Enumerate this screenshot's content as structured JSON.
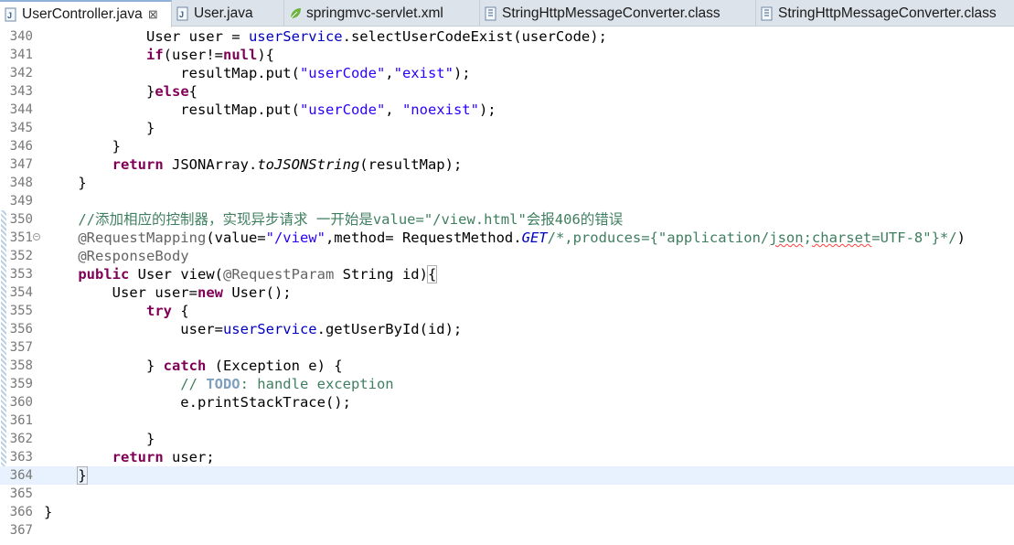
{
  "tabs": [
    {
      "label": "UserController.java",
      "icon": "java-file-icon",
      "active": true,
      "close": "⊠"
    },
    {
      "label": "User.java",
      "icon": "java-file-icon",
      "active": false
    },
    {
      "label": "springmvc-servlet.xml",
      "icon": "spring-xml-icon",
      "active": false
    },
    {
      "label": "StringHttpMessageConverter.class",
      "icon": "class-file-icon",
      "active": false
    },
    {
      "label": "StringHttpMessageConverter.class",
      "icon": "class-file-icon",
      "active": false
    }
  ],
  "lines": [
    {
      "n": "340",
      "segs": [
        [
          "            User user = ",
          ""
        ],
        [
          "userService",
          "field"
        ],
        [
          ".selectUserCodeExist(userCode);",
          ""
        ]
      ]
    },
    {
      "n": "341",
      "segs": [
        [
          "            ",
          ""
        ],
        [
          "if",
          "kw"
        ],
        [
          "(user!=",
          ""
        ],
        [
          "null",
          "kw"
        ],
        [
          "){",
          ""
        ]
      ]
    },
    {
      "n": "342",
      "segs": [
        [
          "                resultMap.put(",
          ""
        ],
        [
          "\"userCode\"",
          "str"
        ],
        [
          ",",
          ""
        ],
        [
          "\"exist\"",
          "str"
        ],
        [
          ");",
          ""
        ]
      ]
    },
    {
      "n": "343",
      "segs": [
        [
          "            }",
          ""
        ],
        [
          "else",
          "kw"
        ],
        [
          "{",
          ""
        ]
      ]
    },
    {
      "n": "344",
      "segs": [
        [
          "                resultMap.put(",
          ""
        ],
        [
          "\"userCode\"",
          "str"
        ],
        [
          ", ",
          ""
        ],
        [
          "\"noexist\"",
          "str"
        ],
        [
          ");",
          ""
        ]
      ]
    },
    {
      "n": "345",
      "segs": [
        [
          "            }",
          ""
        ]
      ]
    },
    {
      "n": "346",
      "segs": [
        [
          "        }",
          ""
        ]
      ]
    },
    {
      "n": "347",
      "segs": [
        [
          "        ",
          ""
        ],
        [
          "return",
          "kw"
        ],
        [
          " JSONArray.",
          ""
        ],
        [
          "toJSONString",
          "ital"
        ],
        [
          "(resultMap);",
          ""
        ]
      ]
    },
    {
      "n": "348",
      "segs": [
        [
          "    }",
          ""
        ]
      ]
    },
    {
      "n": "349",
      "segs": []
    },
    {
      "n": "350",
      "segs": [
        [
          "    //添加相应的控制器，实现异步请求 一开始是value=\"/view.html\"会报406的错误",
          "cmt"
        ]
      ]
    },
    {
      "n": "351",
      "fold": true,
      "segs": [
        [
          "    @RequestMapping",
          "ann"
        ],
        [
          "(value=",
          ""
        ],
        [
          "\"/view\"",
          "str"
        ],
        [
          ",method= RequestMethod.",
          ""
        ],
        [
          "GET",
          "field ital"
        ],
        [
          "/*,produces={\"application/",
          "cmt"
        ],
        [
          "json",
          "cmt squig"
        ],
        [
          ";",
          "cmt"
        ],
        [
          "charset",
          "cmt squig"
        ],
        [
          "=UTF-8\"}*/",
          "cmt"
        ],
        [
          ")",
          ""
        ]
      ]
    },
    {
      "n": "352",
      "segs": [
        [
          "    @ResponseBody",
          "ann"
        ]
      ]
    },
    {
      "n": "353",
      "segs": [
        [
          "    ",
          ""
        ],
        [
          "public",
          "kw"
        ],
        [
          " User view(",
          ""
        ],
        [
          "@RequestParam",
          "ann"
        ],
        [
          " String id)",
          ""
        ],
        [
          "{",
          "bracket"
        ]
      ]
    },
    {
      "n": "354",
      "segs": [
        [
          "        User user=",
          ""
        ],
        [
          "new",
          "kw"
        ],
        [
          " User();",
          ""
        ]
      ]
    },
    {
      "n": "355",
      "segs": [
        [
          "            ",
          ""
        ],
        [
          "try",
          "kw"
        ],
        [
          " {",
          ""
        ]
      ]
    },
    {
      "n": "356",
      "segs": [
        [
          "                user=",
          ""
        ],
        [
          "userService",
          "field"
        ],
        [
          ".getUserById(id);",
          ""
        ]
      ]
    },
    {
      "n": "357",
      "segs": []
    },
    {
      "n": "358",
      "segs": [
        [
          "            } ",
          ""
        ],
        [
          "catch",
          "kw"
        ],
        [
          " (Exception e) {",
          ""
        ]
      ]
    },
    {
      "n": "359",
      "segs": [
        [
          "                // ",
          "cmt"
        ],
        [
          "TODO",
          "todo"
        ],
        [
          ": handle exception",
          "cmt"
        ]
      ]
    },
    {
      "n": "360",
      "segs": [
        [
          "                e.printStackTrace();",
          ""
        ]
      ]
    },
    {
      "n": "361",
      "segs": []
    },
    {
      "n": "362",
      "segs": [
        [
          "            }",
          ""
        ]
      ]
    },
    {
      "n": "363",
      "segs": [
        [
          "        ",
          ""
        ],
        [
          "return",
          "kw"
        ],
        [
          " user;",
          ""
        ]
      ]
    },
    {
      "n": "364",
      "current": true,
      "segs": [
        [
          "    ",
          ""
        ],
        [
          "}",
          "bracket"
        ]
      ]
    },
    {
      "n": "365",
      "segs": []
    },
    {
      "n": "366",
      "segs": [
        [
          "}",
          ""
        ]
      ]
    },
    {
      "n": "367",
      "segs": []
    }
  ],
  "colors": {
    "keyword": "#7f0055",
    "string": "#2a00ff",
    "field": "#0000c0",
    "comment": "#3f7f5f",
    "annotation": "#646464",
    "current_line": "#e8f2fe"
  }
}
